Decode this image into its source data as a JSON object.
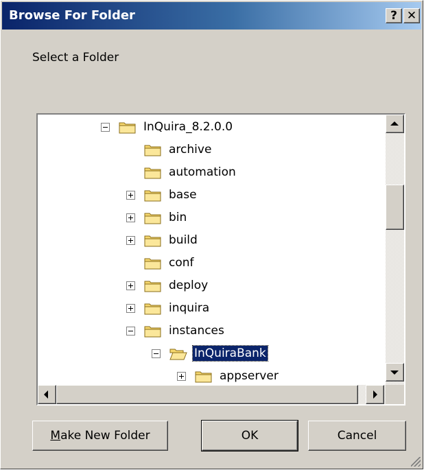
{
  "window": {
    "title": "Browse For Folder",
    "help_label": "?",
    "close_label": "✕"
  },
  "prompt": "Select a Folder",
  "tree": {
    "nodes": [
      {
        "label": "InQuira_8.2.0.0",
        "level": 0,
        "expander": "minus",
        "open": false,
        "selected": false
      },
      {
        "label": "archive",
        "level": 1,
        "expander": "none",
        "open": false,
        "selected": false
      },
      {
        "label": "automation",
        "level": 1,
        "expander": "none",
        "open": false,
        "selected": false
      },
      {
        "label": "base",
        "level": 1,
        "expander": "plus",
        "open": false,
        "selected": false
      },
      {
        "label": "bin",
        "level": 1,
        "expander": "plus",
        "open": false,
        "selected": false
      },
      {
        "label": "build",
        "level": 1,
        "expander": "plus",
        "open": false,
        "selected": false
      },
      {
        "label": "conf",
        "level": 1,
        "expander": "none",
        "open": false,
        "selected": false
      },
      {
        "label": "deploy",
        "level": 1,
        "expander": "plus",
        "open": false,
        "selected": false
      },
      {
        "label": "inquira",
        "level": 1,
        "expander": "plus",
        "open": false,
        "selected": false
      },
      {
        "label": "instances",
        "level": 1,
        "expander": "minus",
        "open": false,
        "selected": false
      },
      {
        "label": "InQuiraBank",
        "level": 2,
        "expander": "minus",
        "open": true,
        "selected": true
      },
      {
        "label": "appserver",
        "level": 3,
        "expander": "plus",
        "open": false,
        "selected": false
      }
    ]
  },
  "buttons": {
    "make_new_folder": {
      "mnemonic": "M",
      "rest": "ake New Folder"
    },
    "ok": "OK",
    "cancel": "Cancel"
  },
  "colors": {
    "selection": "#0a246a",
    "face": "#d4d0c8",
    "folder": "#f5d76e"
  }
}
